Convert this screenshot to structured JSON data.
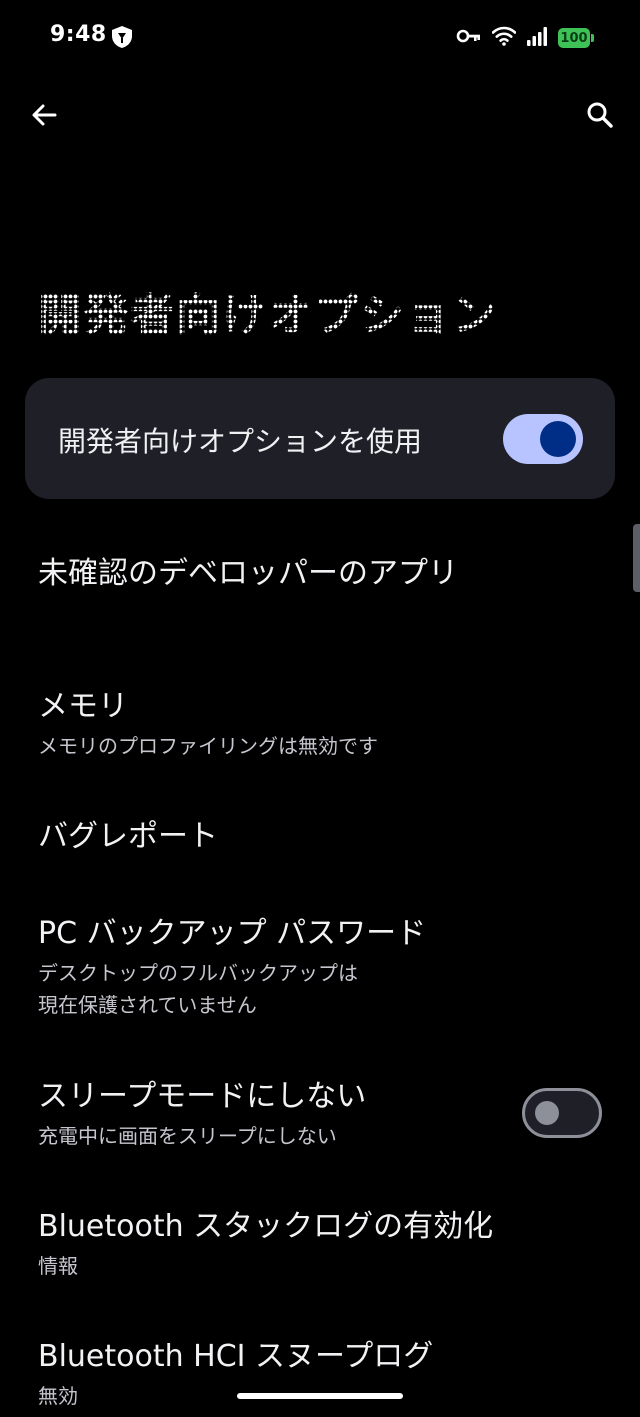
{
  "status_bar": {
    "time": "9:48",
    "app_icon": "shield-app-icon",
    "icons": [
      "vpn-key-icon",
      "wifi-icon",
      "signal-icon"
    ],
    "battery_level": "100",
    "battery_color": "#3ec257"
  },
  "top_bar": {
    "back_icon": "arrow-back-icon",
    "search_icon": "search-icon"
  },
  "page": {
    "title": "開発者向けオプション"
  },
  "main_switch": {
    "label": "開発者向けオプションを使用",
    "checked": true,
    "accent_color": "#b8c4ff"
  },
  "settings": [
    {
      "title": "未確認のデベロッパーのアプリ"
    },
    {
      "title": "メモリ",
      "summary": "メモリのプロファイリングは無効です"
    },
    {
      "title": "バグレポート"
    },
    {
      "title": "PC バックアップ パスワード",
      "summary": "デスクトップのフルバックアップは\n現在保護されていません"
    },
    {
      "title": "スリープモードにしない",
      "summary": "充電中に画面をスリープにしない",
      "toggle_checked": false
    },
    {
      "title": "Bluetooth スタックログの有効化",
      "summary": "情報"
    },
    {
      "title": "Bluetooth HCI スヌープログ",
      "summary": "無効"
    }
  ]
}
